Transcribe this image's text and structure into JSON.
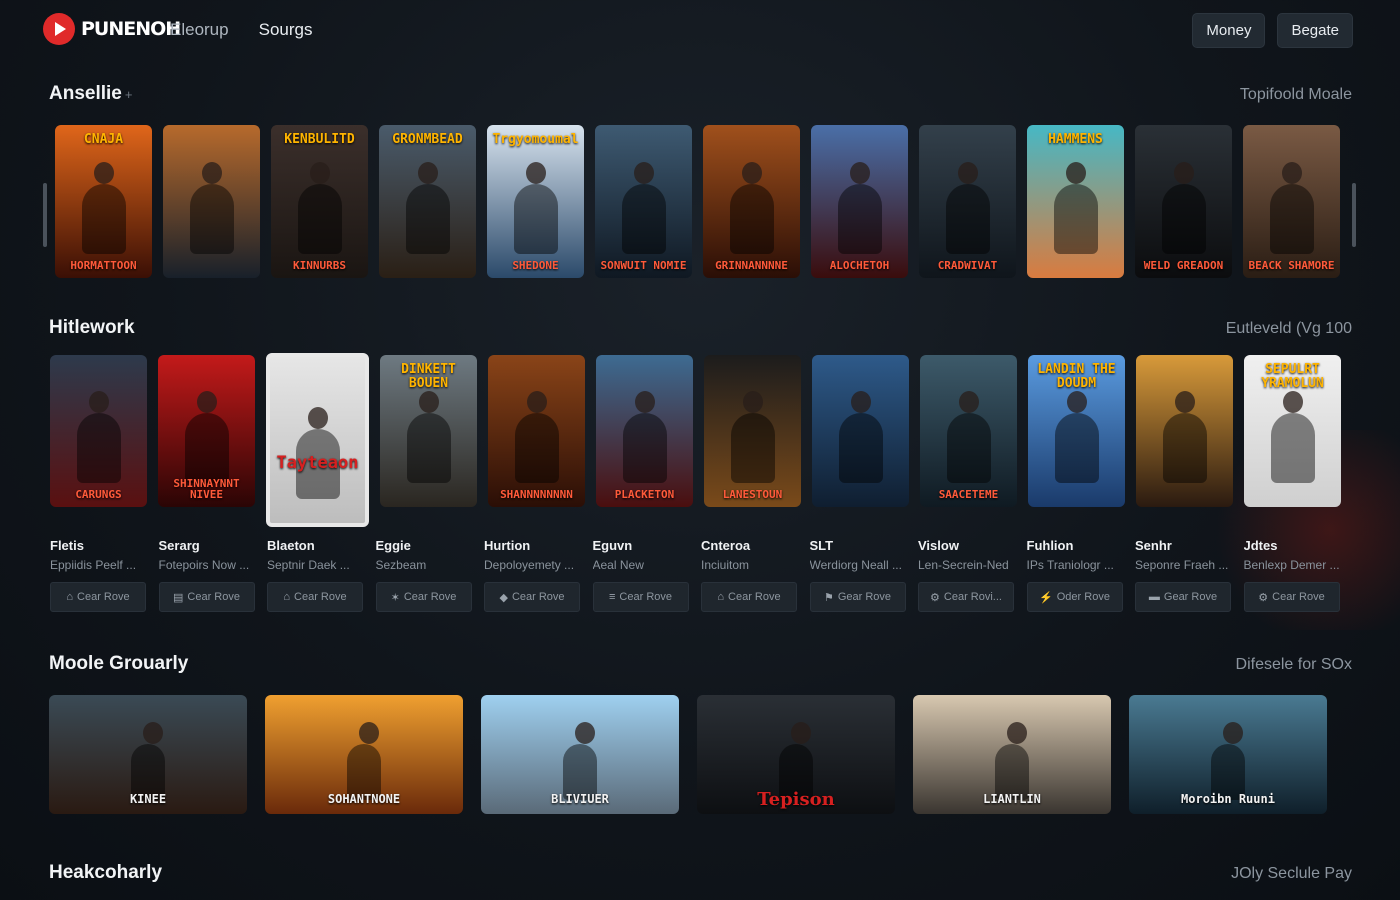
{
  "app": {
    "logo_text": "PUNENOH",
    "nav": [
      "Eleorup",
      "Sourgs"
    ],
    "actions": [
      "Money",
      "Begate"
    ]
  },
  "colors": {
    "accent": "#e02a2a",
    "background": "#10151b",
    "panel": "#222a32"
  },
  "sections": [
    {
      "title": "Ansellie",
      "link": "Topifoold Moale",
      "posters": [
        {
          "title": "CNAJA",
          "tag": "HORMATTOON",
          "c1": "#e0661a",
          "c2": "#3a0f05"
        },
        {
          "title": "",
          "tag": "",
          "c1": "#b76a2c",
          "c2": "#18202a"
        },
        {
          "title": "KENBULITD",
          "tag": "KINNURBS",
          "c1": "#3b2f2b",
          "c2": "#1a1512"
        },
        {
          "title": "GRONMBEAD",
          "tag": "",
          "c1": "#4a5b6b",
          "c2": "#2a1f15"
        },
        {
          "title": "Trgyomoumal",
          "tag": "SHEDONE",
          "c1": "#d7e3ee",
          "c2": "#2b4a6a"
        },
        {
          "title": "",
          "tag": "SONWUIT NOMIE",
          "c1": "#3e5a72",
          "c2": "#0f1822"
        },
        {
          "title": "",
          "tag": "GRINNANNNNE",
          "c1": "#a0501c",
          "c2": "#2a0e06"
        },
        {
          "title": "",
          "tag": "ALOCHETOH",
          "c1": "#4a6fa8",
          "c2": "#3a0c0c"
        },
        {
          "title": "",
          "tag": "CRADWIVAT",
          "c1": "#33404b",
          "c2": "#0f151b"
        },
        {
          "title": "HAMMENS",
          "tag": "",
          "c1": "#46b8c5",
          "c2": "#d97b3f"
        },
        {
          "title": "",
          "tag": "WELD GREADON",
          "c1": "#2a3036",
          "c2": "#0b0c0e"
        },
        {
          "title": "",
          "tag": "BEACK SHAMORE",
          "c1": "#7a5a44",
          "c2": "#2a1d14"
        }
      ]
    },
    {
      "title": "Hitlework",
      "link": "Eutleveld (Vg 100",
      "posters": [
        {
          "title": "",
          "tag": "CARUNGS",
          "c1": "#2d3a4c",
          "c2": "#5a1010"
        },
        {
          "title": "",
          "tag": "SHINNAYNNT NIVEE",
          "c1": "#c41a1a",
          "c2": "#2a0505"
        },
        {
          "title": "",
          "tag": "Tayteaon",
          "c1": "#e6e6e6",
          "c2": "#bdbdbd"
        },
        {
          "title": "DINKETT BOUEN",
          "tag": "",
          "c1": "#6e7a82",
          "c2": "#2a2620"
        },
        {
          "title": "",
          "tag": "SHANNNNNNNN",
          "c1": "#8a4418",
          "c2": "#2a0e06"
        },
        {
          "title": "",
          "tag": "PLACKETON",
          "c1": "#3d6b92",
          "c2": "#4a0e0e"
        },
        {
          "title": "",
          "tag": "LANESTOUN",
          "c1": "#1c1c1c",
          "c2": "#7a4a1a"
        },
        {
          "title": "",
          "tag": "",
          "c1": "#2e5a8a",
          "c2": "#0f1e30"
        },
        {
          "title": "",
          "tag": "SAACETEME",
          "c1": "#3d5a6a",
          "c2": "#0f1a22"
        },
        {
          "title": "LANDIN THE DOUDM",
          "tag": "",
          "c1": "#5a9be0",
          "c2": "#1a3a6a"
        },
        {
          "title": "",
          "tag": "",
          "c1": "#d89a3a",
          "c2": "#2a1a10"
        },
        {
          "title": "SEPULRT YRAMOLUN",
          "tag": "",
          "c1": "#f0f0f0",
          "c2": "#cfcfcf"
        }
      ],
      "items": [
        {
          "name": "Fletis",
          "sub": "Eppiidis Peelf ...",
          "action": "Cear Rove",
          "icon": "cart-icon"
        },
        {
          "name": "Serarg",
          "sub": "Fotepoirs Now ...",
          "action": "Cear Rove",
          "icon": "film-icon"
        },
        {
          "name": "Blaeton",
          "sub": "Septnir Daek ...",
          "action": "Cear Rove",
          "icon": "cart-icon"
        },
        {
          "name": "Eggie",
          "sub": "Sezbeam",
          "action": "Cear Rove",
          "icon": "link-icon"
        },
        {
          "name": "Hurtion",
          "sub": "Depoloyemety ...",
          "action": "Cear Rove",
          "icon": "pin-icon"
        },
        {
          "name": "Eguvn",
          "sub": "Aeal New",
          "action": "Cear Rove",
          "icon": "list-icon"
        },
        {
          "name": "Cnteroa",
          "sub": "Inciuitom",
          "action": "Cear Rove",
          "icon": "cart-icon"
        },
        {
          "name": "SLT",
          "sub": "Werdiorg Neall ...",
          "action": "Gear Rove",
          "icon": "flag-icon"
        },
        {
          "name": "Vislow",
          "sub": "Len-Secrein-Ned",
          "action": "Cear Rovi...",
          "icon": "gear-icon"
        },
        {
          "name": "Fuhlion",
          "sub": "IPs Traniologr ...",
          "action": "Oder Rove",
          "icon": "bolt-icon"
        },
        {
          "name": "Senhr",
          "sub": "Seponre Fraeh ...",
          "action": "Gear Rove",
          "icon": "screen-icon"
        },
        {
          "name": "Jdtes",
          "sub": "Benlexp Demer ...",
          "action": "Cear Rove",
          "icon": "gear-icon"
        }
      ]
    },
    {
      "title": "Moole Grouarly",
      "link": "Difesele for SOx",
      "posters": [
        {
          "title": "",
          "tag": "KINEE",
          "c1": "#3a4a55",
          "c2": "#2a1a12"
        },
        {
          "title": "",
          "tag": "SOHANTNONE",
          "c1": "#f0a030",
          "c2": "#6a2a0a"
        },
        {
          "title": "",
          "tag": "BLIVIUER",
          "c1": "#9fd0f0",
          "c2": "#5a6a78"
        },
        {
          "title": "",
          "tag": "Tepison",
          "c1": "#2a2f35",
          "c2": "#0d0f12"
        },
        {
          "title": "",
          "tag": "LIANTLIN",
          "c1": "#d8c8b0",
          "c2": "#3a3530"
        },
        {
          "title": "",
          "tag": "Moroibn Ruuni",
          "c1": "#4a7a92",
          "c2": "#0f1f2a"
        }
      ]
    },
    {
      "title": "Heakcoharly",
      "link": "JOly Seclule Pay"
    }
  ]
}
